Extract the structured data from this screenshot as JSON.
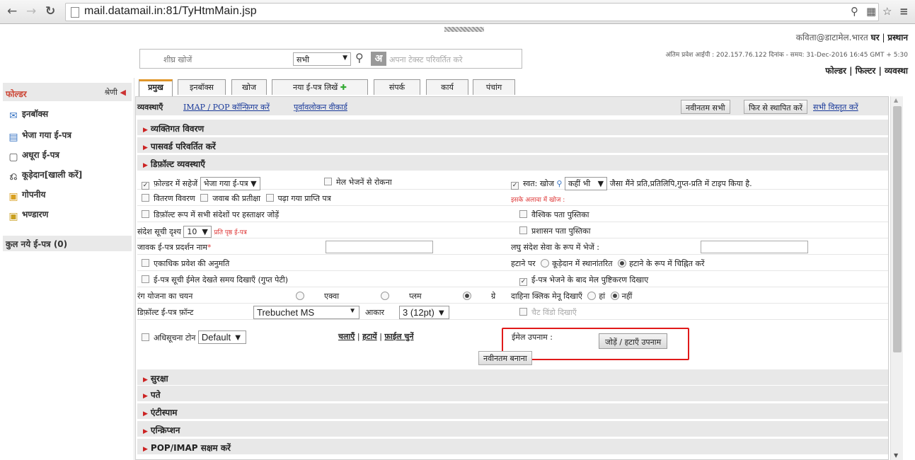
{
  "browser": {
    "url": "mail.datamail.in:81/TyHtmMain.jsp",
    "icons": [
      "back-icon",
      "forward-icon",
      "reload-icon",
      "page-icon",
      "zoom-icon",
      "translate-icon",
      "star-icon",
      "menu-icon"
    ]
  },
  "header": {
    "user_email": "कविता@डाटामेल.भारत",
    "home": "घर",
    "logout": "प्रस्थान",
    "last_login": "अंतिम प्रवेश आईपी : 202.157.76.122 दिनांक - समय: 31-Dec-2016 16:45 GMT + 5:30",
    "links": [
      "फोल्डर",
      "फिल्टर",
      "व्यवस्था"
    ],
    "search_placeholder": "शीघ्र खोजें",
    "search_scope": "सभी",
    "lang_button": "अ",
    "lang_hint": "अपना टेक्स्ट परिवर्तित करे"
  },
  "sidebar": {
    "title": "फोल्डर",
    "category": "श्रेणी",
    "items": [
      {
        "label": "इनबॉक्स",
        "icon": "inbox-icon"
      },
      {
        "label": "भेजा गया ई-पत्र",
        "icon": "sent-icon"
      },
      {
        "label": "अधूरा ई-पत्र",
        "icon": "draft-icon"
      },
      {
        "label": "कूड़ेदान[खाली करें]",
        "icon": "trash-icon"
      },
      {
        "label": "गोपनीय",
        "icon": "lock-icon"
      },
      {
        "label": "भण्डारण",
        "icon": "storage-folder-icon"
      }
    ],
    "new_mail": "कुल नये ई-पत्र (0)"
  },
  "tabs": [
    "प्रमुख",
    "इनबॉक्स",
    "खोज",
    "नया ई-पत्र लिखें",
    "संपर्क",
    "कार्य",
    "पंचांग"
  ],
  "toolbar": {
    "label": "व्यवस्थाएँ",
    "link_imap": "IMAP / POP कॉन्फ़िगर करें",
    "link_preview": "पूर्वावलोकन वीकार्ड",
    "btn_latest_all": "नवीनतम सभी",
    "btn_reset": "फिर से स्थापित करें",
    "link_expand": "सभी विस्तृत करें"
  },
  "sections_top": [
    "व्यक्तिगत विवरण",
    "पासवर्ड परिवर्तित करें",
    "डिफ़ॉल्ट व्यवस्थाएँ"
  ],
  "settings": {
    "save_in_folder": "फ़ोल्डर में सहेजें",
    "folder_value": "भेजा गया ई-पत्र",
    "block_mail": "मेल भेजनें से रोकना",
    "autosearch": "स्वत: खोज",
    "autosearch_scope": "कहीं भी",
    "autosearch_hint": "जैसा मैंने प्रति,प्रतिलिपि,गुप्त-प्रति में टाइप किया है.",
    "delivery": "वितरण विवरण",
    "await_reply": "जवाब की प्रतीक्षा",
    "read_receipt": "पढ़ा गया प्राप्ति पत्र",
    "search_note": "इसके अलावा में खोज :",
    "signature": "डिफ़ॉल्ट रूप में सभी संदेशों पर हस्ताक्षर जोड़ें",
    "global_book": "वैश्विक पता पुस्तिका",
    "list_view": "संदेश सूची दृश्य",
    "list_count": "10",
    "per_page": "प्रति पृष्ठ ई-पत्र",
    "admin_book": "प्रशासन पता पुस्तिका",
    "sender_name": "जावक ई-पत्र प्रदर्शन नाम",
    "sms_send": "लघु संदेश सेवा के रूप में भेजें :",
    "multi_login": "एकाधिक प्रवेश की अनुमति",
    "on_delete": "हटाने पर",
    "move_trash": "कूड़ेदान में स्थानांतरित",
    "mark_deleted": "हटाने के रूप में चिह्नित करें",
    "show_mail_list": "ई-पत्र सूची ईमेल देखते समय दिखाएँ (गुप्त पेटी)",
    "show_confirm": "ई-पत्र भेजने के बाद मेल पुष्टिकरण दिखाए",
    "color_scheme": "रंग योजना का चयन",
    "color_options": [
      "एक्वा",
      "प्लम",
      "ग्रे"
    ],
    "right_click": "दाहिना क्लिक मेनू दिखाएँ",
    "yes": "हां",
    "no": "नहीं",
    "default_font": "डिफ़ॉल्ट ई-पत्र फ़ॉन्ट",
    "font_value": "Trebuchet MS",
    "size_label": "आकार",
    "size_value": "3 (12pt)",
    "chat_window": "चैट विंडो दिखाएँ",
    "notif_tone": "अधिसूचना टोन",
    "tone_value": "Default",
    "play": "चलाएँ",
    "remove": "हटायें",
    "choose_file": "फ़ाईल चुनें",
    "alias_label": "ईमेल उपनाम :",
    "alias_button": "जोड़ें / हटाएँ उपनाम",
    "update_button": "नवीनतम बनाना"
  },
  "sections_bottom": [
    "सुरक्षा",
    "पते",
    "एंटीस्पाम",
    "एन्क्रिप्शन",
    "POP/IMAP सक्षम करें"
  ],
  "colors": {
    "accent_tab": "#e0962a",
    "highlight_box": "#e01a1a",
    "link": "#1a3a9a",
    "folder_title": "#c43"
  }
}
